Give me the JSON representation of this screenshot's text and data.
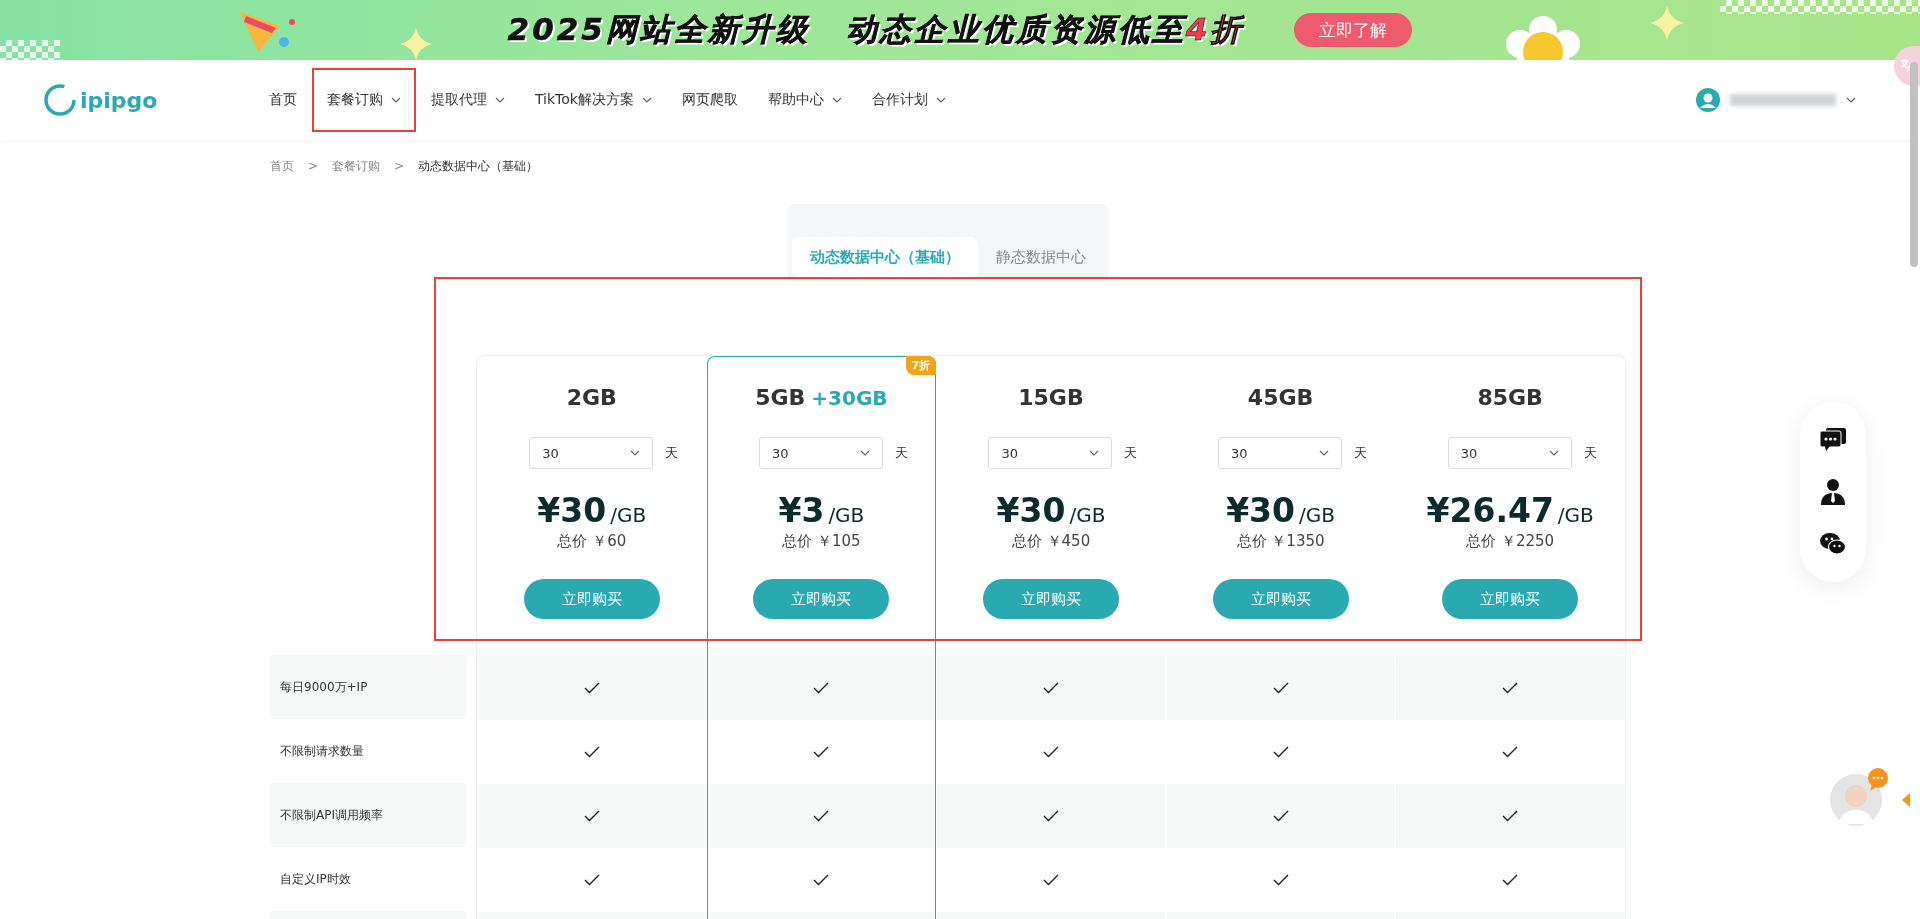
{
  "banner": {
    "headline": "2025网站全新升级",
    "promo": "动态企业优质资源低至",
    "highlight": "4折",
    "button": "立即了解"
  },
  "header": {
    "logo": "ipipgo",
    "nav": [
      {
        "label": "首页",
        "has_menu": false,
        "highlighted": false
      },
      {
        "label": "套餐订购",
        "has_menu": true,
        "highlighted": true
      },
      {
        "label": "提取代理",
        "has_menu": true,
        "highlighted": false
      },
      {
        "label": "TikTok解决方案",
        "has_menu": true,
        "highlighted": false
      },
      {
        "label": "网页爬取",
        "has_menu": false,
        "highlighted": false
      },
      {
        "label": "帮助中心",
        "has_menu": true,
        "highlighted": false
      },
      {
        "label": "合作计划",
        "has_menu": true,
        "highlighted": false
      }
    ]
  },
  "breadcrumb": [
    "首页",
    "套餐订购",
    "动态数据中心（基础）"
  ],
  "breadcrumb_separator": ">",
  "tabs": [
    {
      "label": "动态数据中心（基础）",
      "selected": true
    },
    {
      "label": "静态数据中心",
      "selected": false
    }
  ],
  "plans_highlighted": true,
  "plans": [
    {
      "size": "2GB",
      "days": "30",
      "unit": "天",
      "price": "¥30",
      "per": "/GB",
      "total": "总价 ￥60",
      "button": "立即购买",
      "selected": false
    },
    {
      "size": "5GB",
      "bonus": "+30GB",
      "badge": "7折",
      "days": "30",
      "unit": "天",
      "price": "¥3",
      "per": "/GB",
      "total": "总价 ￥105",
      "button": "立即购买",
      "selected": true
    },
    {
      "size": "15GB",
      "days": "30",
      "unit": "天",
      "price": "¥30",
      "per": "/GB",
      "total": "总价 ￥450",
      "button": "立即购买",
      "selected": false
    },
    {
      "size": "45GB",
      "days": "30",
      "unit": "天",
      "price": "¥30",
      "per": "/GB",
      "total": "总价 ￥1350",
      "button": "立即购买",
      "selected": false
    },
    {
      "size": "85GB",
      "days": "30",
      "unit": "天",
      "price": "¥26.47",
      "per": "/GB",
      "total": "总价 ￥2250",
      "button": "立即购买",
      "selected": false
    }
  ],
  "features": [
    {
      "label": "每日9000万+IP",
      "included": [
        true,
        true,
        true,
        true,
        true
      ]
    },
    {
      "label": "不限制请求数量",
      "included": [
        true,
        true,
        true,
        true,
        true
      ]
    },
    {
      "label": "不限制API调用频率",
      "included": [
        true,
        true,
        true,
        true,
        true
      ]
    },
    {
      "label": "自定义IP时效",
      "included": [
        true,
        true,
        true,
        true,
        true
      ]
    }
  ]
}
